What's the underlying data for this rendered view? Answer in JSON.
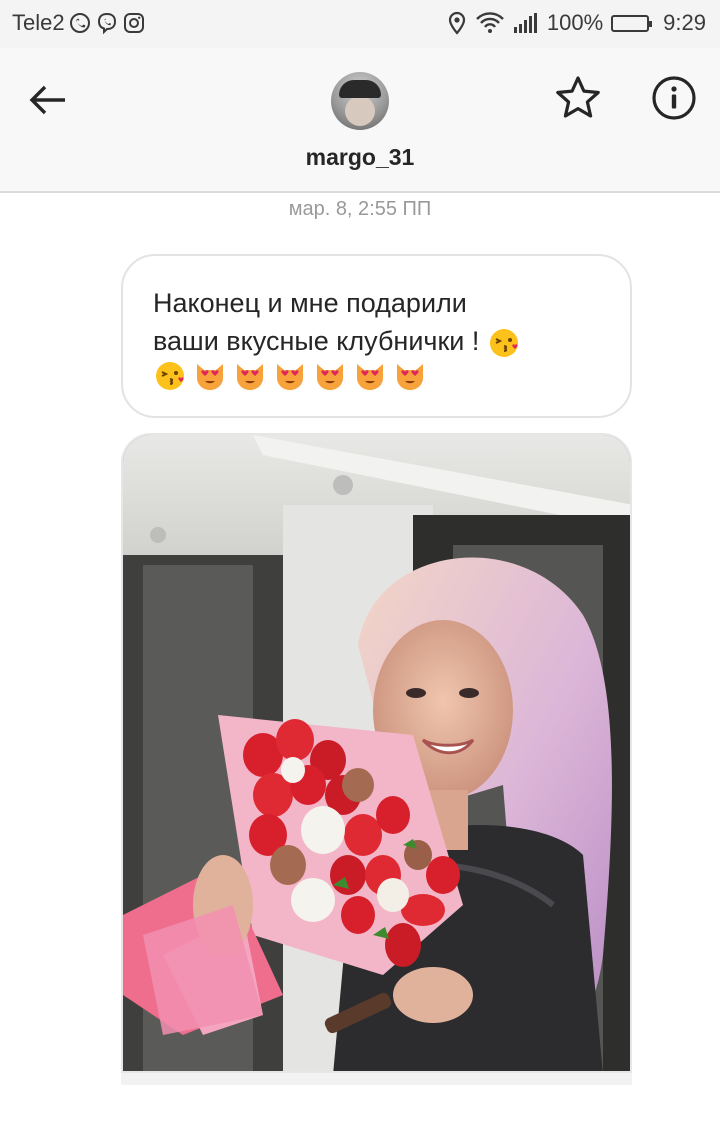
{
  "status_bar": {
    "carrier": "Tele2",
    "battery": "100%",
    "battery_level": 1.0,
    "time": "9:29",
    "icons": [
      "whatsapp-icon",
      "viber-icon",
      "instagram-icon",
      "location-icon",
      "wifi-icon",
      "signal-icon",
      "battery-icon"
    ]
  },
  "header": {
    "username": "margo_31",
    "icons": [
      "back-arrow-icon",
      "star-icon",
      "info-icon"
    ]
  },
  "conversation": {
    "timestamp": "мар. 8, 2:55 ПП",
    "messages": [
      {
        "type": "text",
        "text": "Наконец и мне подарили\nваши вкусные клубнички !",
        "emojis": [
          "kissing-face-icon",
          "kissing-face-icon",
          "heart-eyes-cat-icon",
          "heart-eyes-cat-icon",
          "heart-eyes-cat-icon",
          "heart-eyes-cat-icon",
          "heart-eyes-cat-icon",
          "heart-eyes-cat-icon"
        ]
      },
      {
        "type": "photo",
        "description_icon": "photo-icon"
      }
    ]
  },
  "colors": {
    "status_bar_bg": "#f4f4f4",
    "header_bg": "#f8f8f8",
    "bubble_border": "#e3e3e3",
    "text": "#262626",
    "muted": "#999999"
  }
}
